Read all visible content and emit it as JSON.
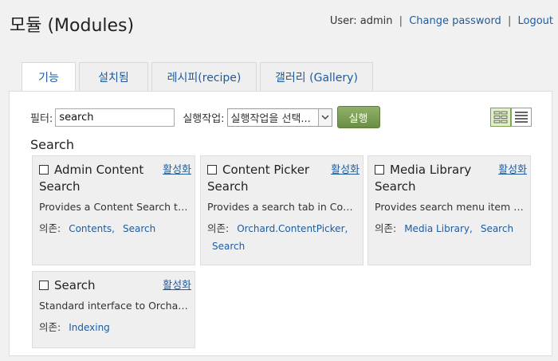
{
  "header": {
    "title": "모듈 (Modules)",
    "user_text": "User: admin",
    "change_password": "Change password",
    "logout": "Logout",
    "separator": "|"
  },
  "tabs": [
    {
      "label": "기능",
      "active": true
    },
    {
      "label": "설치됨",
      "active": false
    },
    {
      "label": "레시피(recipe)",
      "active": false
    },
    {
      "label": "갤러리 (Gallery)",
      "active": false
    }
  ],
  "toolbar": {
    "filter_label": "필터:",
    "filter_value": "search",
    "bulk_label": "실행작업:",
    "bulk_value": "실행작업을 선택...",
    "run_label": "실행"
  },
  "section": {
    "title": "Search"
  },
  "modules": [
    {
      "name": "Admin Content Search",
      "enable": "활성화",
      "description": "Provides a Content Search tab ...",
      "deps_label": "의존:",
      "deps": [
        "Contents,",
        "Search"
      ]
    },
    {
      "name": "Content Picker Search",
      "enable": "활성화",
      "description": "Provides a search tab in Conte...",
      "deps_label": "의존:",
      "deps": [
        "Orchard.ContentPicker,",
        "Search"
      ]
    },
    {
      "name": "Media Library Search",
      "enable": "활성화",
      "description": "Provides search menu item in t...",
      "deps_label": "의존:",
      "deps": [
        "Media Library,",
        "Search"
      ]
    },
    {
      "name": "Search",
      "enable": "활성화",
      "description": "Standard interface to Orchard'...",
      "deps_label": "의존:",
      "deps": [
        "Indexing"
      ]
    }
  ],
  "colors": {
    "link": "#1e5b9e",
    "run_button": "#6f9446",
    "card_bg": "#efefef"
  }
}
